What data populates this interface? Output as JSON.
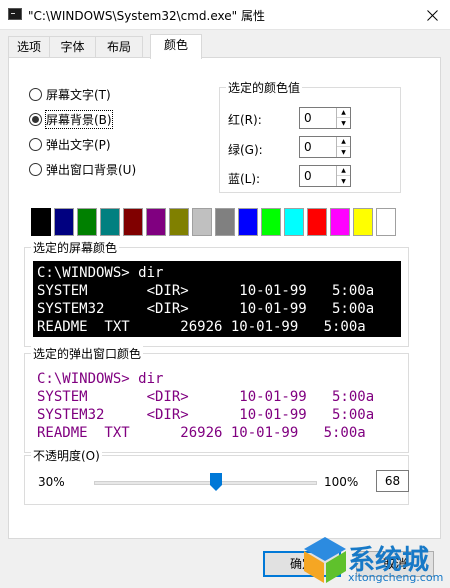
{
  "window": {
    "title": "\"C:\\WINDOWS\\System32\\cmd.exe\" 属性"
  },
  "tabs": [
    {
      "label": "选项",
      "active": false
    },
    {
      "label": "字体",
      "active": false
    },
    {
      "label": "布局",
      "active": false
    },
    {
      "label": "颜色",
      "active": true
    }
  ],
  "radios": [
    {
      "label": "屏幕文字(T)",
      "checked": false
    },
    {
      "label": "屏幕背景(B)",
      "checked": true
    },
    {
      "label": "弹出文字(P)",
      "checked": false
    },
    {
      "label": "弹出窗口背景(U)",
      "checked": false
    }
  ],
  "selected_color": {
    "title": "选定的颜色值",
    "red_label": "红(R):",
    "red_value": "0",
    "green_label": "绿(G):",
    "green_value": "0",
    "blue_label": "蓝(L):",
    "blue_value": "0"
  },
  "palette": [
    "#000000",
    "#000080",
    "#008000",
    "#008080",
    "#800000",
    "#800080",
    "#808000",
    "#c0c0c0",
    "#808080",
    "#0000ff",
    "#00ff00",
    "#00ffff",
    "#ff0000",
    "#ff00ff",
    "#ffff00",
    "#ffffff"
  ],
  "screen_preview": {
    "title": "选定的屏幕颜色",
    "bg": "#000000",
    "fg": "#ffffff",
    "lines": [
      "C:\\WINDOWS> dir",
      "SYSTEM       <DIR>      10-01-99   5:00a",
      "SYSTEM32     <DIR>      10-01-99   5:00a",
      "README  TXT      26926 10-01-99   5:00a"
    ]
  },
  "popup_preview": {
    "title": "选定的弹出窗口颜色",
    "bg": "#ffffff",
    "fg": "#800080",
    "lines": [
      "C:\\WINDOWS> dir",
      "SYSTEM       <DIR>      10-01-99   5:00a",
      "SYSTEM32     <DIR>      10-01-99   5:00a",
      "README  TXT      26926 10-01-99   5:00a"
    ]
  },
  "opacity": {
    "title": "不透明度(O)",
    "min_label": "30%",
    "max_label": "100%",
    "value": "68"
  },
  "buttons": {
    "ok": "确定",
    "cancel": "取消"
  },
  "watermark": {
    "text": "系统城",
    "sub": "xitongcheng.com"
  },
  "colors": {
    "accent": "#0078d7",
    "watermark": "#1779c7"
  }
}
